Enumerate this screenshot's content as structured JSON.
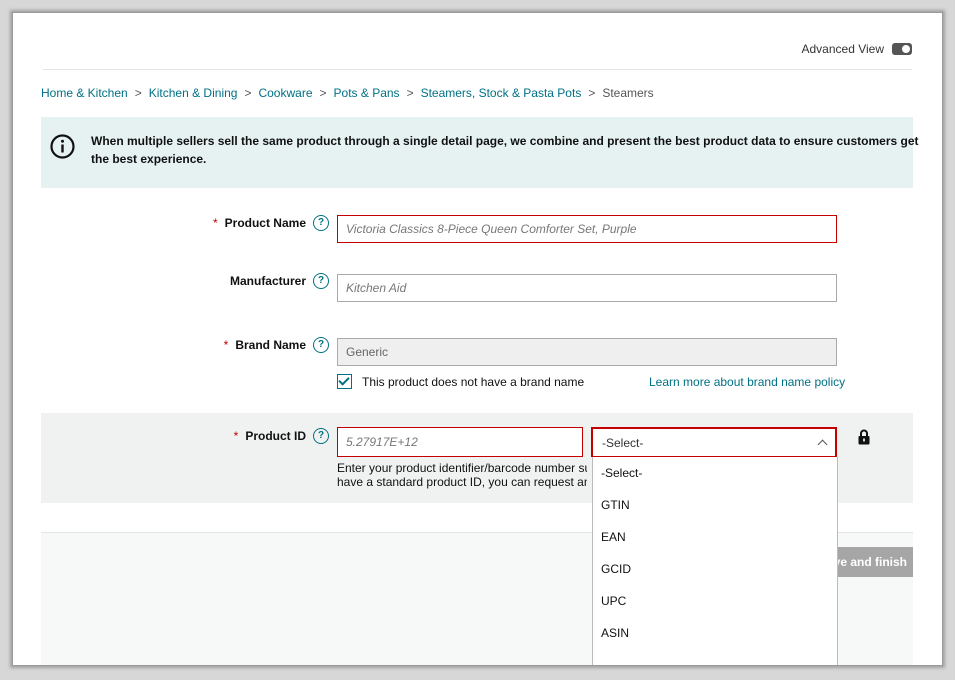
{
  "header": {
    "advanced_view_label": "Advanced View"
  },
  "breadcrumb": {
    "items": [
      "Home & Kitchen",
      "Kitchen & Dining",
      "Cookware",
      "Pots & Pans",
      "Steamers, Stock & Pasta Pots"
    ],
    "separator": ">",
    "current": "Steamers"
  },
  "info": {
    "message": "When multiple sellers sell the same product through a single detail page, we combine and present the best product data to ensure customers get the best experience."
  },
  "form": {
    "required_marker": "*",
    "help_glyph": "?",
    "product_name": {
      "label": "Product Name",
      "value": "Victoria Classics 8-Piece Queen Comforter Set, Purple"
    },
    "manufacturer": {
      "label": "Manufacturer",
      "value": "Kitchen Aid"
    },
    "brand_name": {
      "label": "Brand Name",
      "value": "Generic",
      "no_brand_checkbox_label": "This product does not have a brand name",
      "no_brand_checked": true,
      "policy_link": "Learn more about brand name policy"
    },
    "product_id": {
      "label": "Product ID",
      "value": "5.27917E+12",
      "helper_text_line1": "Enter your product identifier/barcode number such",
      "helper_text_line2": "have a standard product ID, you can request an ex",
      "id_type_selected": "-Select-",
      "id_type_options": [
        "-Select-",
        "GTIN",
        "EAN",
        "GCID",
        "UPC",
        "ASIN"
      ]
    }
  },
  "footer": {
    "save_finish_label": "Save and finish"
  },
  "colors": {
    "link": "#007185",
    "error": "#c40000",
    "info_bg": "#e6f2f2"
  }
}
